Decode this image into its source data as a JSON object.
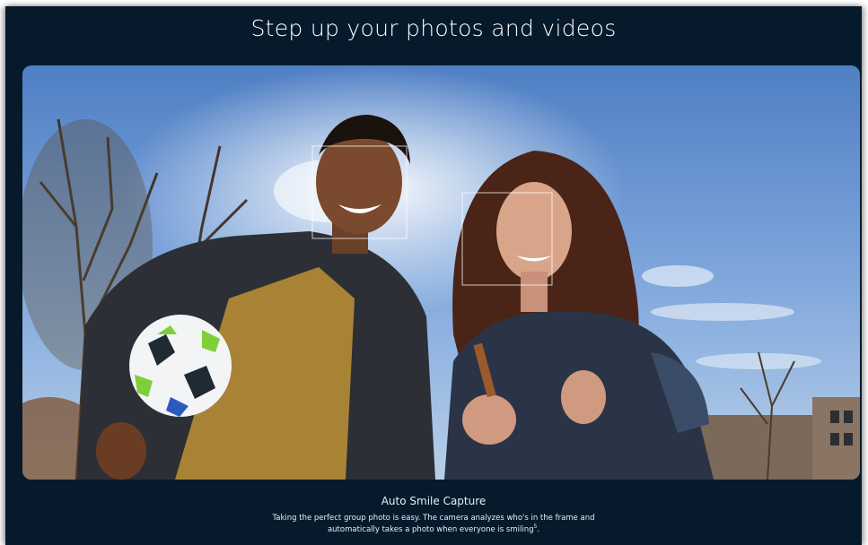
{
  "headline": "Step up your photos and videos",
  "feature": {
    "title": "Auto Smile Capture",
    "body_line1": "Taking the perfect group photo is easy. The camera analyzes who's in the frame and",
    "body_line2": "automatically takes a photo when everyone is smiling",
    "footnote_mark": "5"
  },
  "colors": {
    "background": "#061a2c",
    "text": "#ffffff"
  }
}
